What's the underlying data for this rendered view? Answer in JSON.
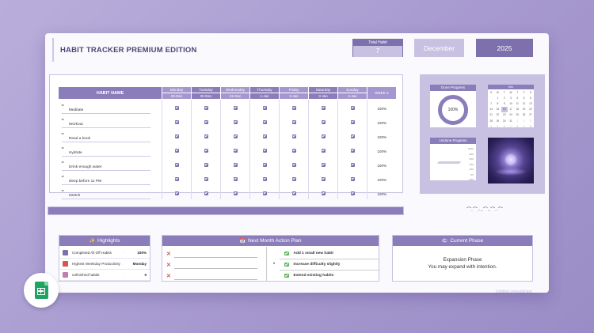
{
  "header": {
    "title": "HABIT TRACKER PREMIUM EDITION",
    "total_habit_label": "Total Habit",
    "total_habit_value": "7",
    "month": "December",
    "year": "2025"
  },
  "tracker": {
    "habit_col_header": "HABIT NAME",
    "week_col_header": "WEEK 5",
    "days": [
      {
        "name": "Monday",
        "date": "29-Dec",
        "color": "#a497cf"
      },
      {
        "name": "Tuesday",
        "date": "30-Dec",
        "color": "#8a7dba"
      },
      {
        "name": "Wednesday",
        "date": "31-Dec",
        "color": "#a497cf"
      },
      {
        "name": "Thursday",
        "date": "1-Jan",
        "color": "#8a7dba"
      },
      {
        "name": "Friday",
        "date": "2-Jan",
        "color": "#a497cf"
      },
      {
        "name": "Saturday",
        "date": "3-Jan",
        "color": "#8a7dba"
      },
      {
        "name": "Sunday",
        "date": "4-Jan",
        "color": "#a497cf"
      }
    ],
    "habits": [
      {
        "name": "Meditate",
        "week": "100%"
      },
      {
        "name": "Workout",
        "week": "100%"
      },
      {
        "name": "Read a book",
        "week": "100%"
      },
      {
        "name": "Hydrate",
        "week": "100%"
      },
      {
        "name": "Drink enough water",
        "week": "100%"
      },
      {
        "name": "sleep before 11 PM",
        "week": "100%"
      },
      {
        "name": "stretch",
        "week": "100%"
      }
    ]
  },
  "done_progress": {
    "title": "Done Progress",
    "value": "100%"
  },
  "undone_progress": {
    "title": "Undone Progress",
    "ticks": [
      "100%",
      "80%",
      "60%",
      "40%",
      "20%",
      "0%",
      "-20%"
    ]
  },
  "calendar": {
    "month": "Dec",
    "weekdays": [
      "S",
      "M",
      "T",
      "W",
      "T",
      "F",
      "S"
    ],
    "weeks": [
      [
        "",
        "1",
        "2",
        "3",
        "4",
        "5",
        "6"
      ],
      [
        "7",
        "8",
        "9",
        "10",
        "11",
        "12",
        "13"
      ],
      [
        "14",
        "15",
        "16",
        "17",
        "18",
        "19",
        "20"
      ],
      [
        "21",
        "22",
        "23",
        "24",
        "25",
        "26",
        "27"
      ],
      [
        "28",
        "29",
        "30",
        "31",
        "1",
        "2",
        "3"
      ],
      [
        "4",
        "5",
        "6",
        "7",
        "8",
        "9",
        "10"
      ]
    ],
    "highlight": "16"
  },
  "squiggle": "⌒.⌒.·..⌒..⌒.·⌒",
  "highlights": {
    "title": "Highlights",
    "rows": [
      {
        "label": "Completed All Off Habits",
        "sep": ":",
        "value": "100%",
        "icon_color": "#7d70ad"
      },
      {
        "label": "Highest Weekday Productivity",
        "sep": ":",
        "value": "Monday",
        "icon_color": "#d9534f"
      },
      {
        "label": "unfinished habits",
        "sep": ":",
        "value": "0",
        "icon_color": "#c37cb0"
      }
    ]
  },
  "action_plan": {
    "title": "Next Month Action Plan",
    "bullet": "•",
    "cross": "✕",
    "items": [
      "Add 1 small new habit",
      "Increase difficulty slightly",
      "Extend existing habits"
    ]
  },
  "phase": {
    "title": "Current Phase",
    "line1": "Expansion Phase",
    "line2": "You may expand with intention."
  },
  "watermark": "Untitled spreadsheet"
}
